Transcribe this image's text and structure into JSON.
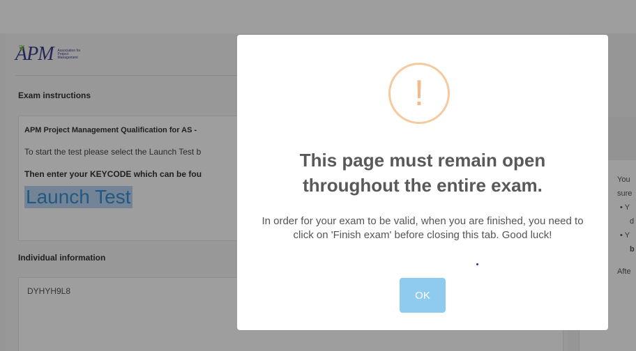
{
  "logo": {
    "mark": "APM",
    "subtext": "Association for Project Management"
  },
  "instructions": {
    "title": "Exam instructions",
    "heading": "APM Project Management Qualification for AS -",
    "line1": "To start the test please select the Launch Test b",
    "line2": "Then enter your KEYCODE which can be fou",
    "launch_label": "Launch Test"
  },
  "individual": {
    "title": "Individual information",
    "keycode": "DYHYH9L8"
  },
  "right_panel": {
    "line1": "You",
    "line2": "sure",
    "bullet1": "• Y",
    "bullet1b": "d",
    "bullet2": "• Y",
    "bullet2b": "b",
    "after": "Afte"
  },
  "modal": {
    "icon_glyph": "!",
    "title": "This page must remain open throughout the entire exam.",
    "body": "In order for your exam to be valid, when you are finished, you need to click on 'Finish exam' before closing this tab. Good luck!",
    "ok_label": "OK"
  },
  "colors": {
    "overlay": "#000000",
    "ok_button": "#8fcbee",
    "warning_icon": "#f6c9a0",
    "launch_link": "#3a8fd0"
  }
}
